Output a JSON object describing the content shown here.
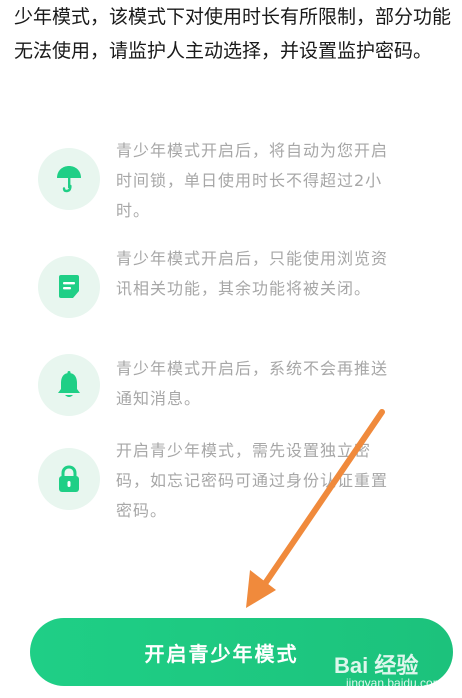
{
  "intro": {
    "text": "少年模式，该模式下对使用时长有所限制，部分功能无法使用，请监护人主动选择，并设置监护密码。"
  },
  "features": [
    {
      "icon": "umbrella-icon",
      "text": "青少年模式开启后，将自动为您开启时间锁，单日使用时长不得超过2小时。"
    },
    {
      "icon": "document-icon",
      "text": "青少年模式开启后，只能使用浏览资讯相关功能，其余功能将被关闭。"
    },
    {
      "icon": "bell-icon",
      "text": "青少年模式开启后，系统不会再推送通知消息。"
    },
    {
      "icon": "lock-icon",
      "text": "开启青少年模式，需先设置独立密码，如忘记密码可通过身份认证重置密码。"
    }
  ],
  "cta": {
    "label": "开启青少年模式"
  },
  "watermark": {
    "logo": "Bai 经验",
    "url": "jingyan.baidu.com"
  },
  "colors": {
    "accent": "#1fcf86",
    "icon_bg": "#e8f6ef",
    "text_muted": "#a7a7a7",
    "arrow": "#f08a3c"
  }
}
